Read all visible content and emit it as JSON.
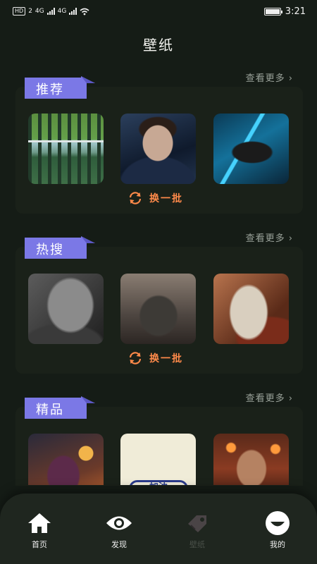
{
  "status_bar": {
    "left_icons": [
      "HD",
      "2",
      "4G",
      "4G",
      "wifi"
    ],
    "time": "3:21"
  },
  "page": {
    "title": "壁纸"
  },
  "sections": [
    {
      "tag": "推荐",
      "more": "查看更多 ›",
      "refresh": "换一批",
      "thumbs": [
        "art-field",
        "art-boy",
        "art-hero"
      ]
    },
    {
      "tag": "热搜",
      "more": "查看更多 ›",
      "refresh": "换一批",
      "thumbs": [
        "art-old",
        "art-knight",
        "art-assassin"
      ]
    },
    {
      "tag": "精品",
      "more": "查看更多 ›",
      "thumbs": [
        "art-jinx",
        "art-shirt",
        "art-warrior"
      ]
    }
  ],
  "thumb_text": {
    "shirt": "加油"
  },
  "colors": {
    "background": "#151c16",
    "tag": "#7b78e6",
    "accent": "#ff8a4a",
    "muted": "#9aa29a"
  },
  "nav": [
    {
      "label": "首页",
      "icon": "home-icon",
      "active": true
    },
    {
      "label": "发现",
      "icon": "eye-icon",
      "active": true
    },
    {
      "label": "壁纸",
      "icon": "tag-icon",
      "active": false
    },
    {
      "label": "我的",
      "icon": "smile-icon",
      "active": true
    }
  ]
}
